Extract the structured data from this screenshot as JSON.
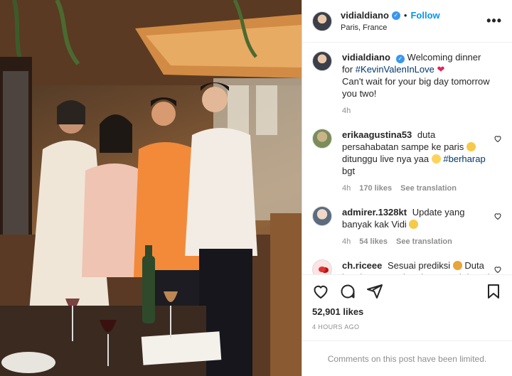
{
  "post": {
    "username": "vidialdiano",
    "location": "Paris, France",
    "follow_label": "Follow",
    "more_label": "•••",
    "caption_text": "Welcoming dinner for",
    "caption_tag": "#KevinValenInLove",
    "caption_heart": "❤",
    "caption_line2": "Can't wait for your big day tomorrow you two!",
    "caption_time": "4h",
    "likes": "52,901 likes",
    "posted_ago": "4 HOURS AGO",
    "comments_limited": "Comments on this post have been limited."
  },
  "comments": [
    {
      "username": "erikaagustina53",
      "text_a": "duta persahabatan sampe ke paris",
      "text_b": "ditunggu live nya yaa",
      "tag": "#berharap",
      "text_c": "bgt",
      "time": "4h",
      "likes": "170 likes",
      "translate": "See translation"
    },
    {
      "username": "admirer.1328kt",
      "text_a": "Update yang banyak kak Vidi",
      "time": "4h",
      "likes": "54 likes",
      "translate": "See translation"
    },
    {
      "username": "ch.riceee",
      "text_a": "Sesuai prediksi",
      "text_b": "Duta kondangan ga kondangan tuh bagai"
    }
  ],
  "colors": {
    "accent": "#0095f6",
    "verified": "#3897f0",
    "heart": "#e0245e",
    "muted": "#8e8e8e"
  },
  "icons": [
    "verified-badge-icon",
    "more-options-icon",
    "like-heart-icon",
    "comment-icon",
    "share-icon",
    "save-bookmark-icon"
  ]
}
